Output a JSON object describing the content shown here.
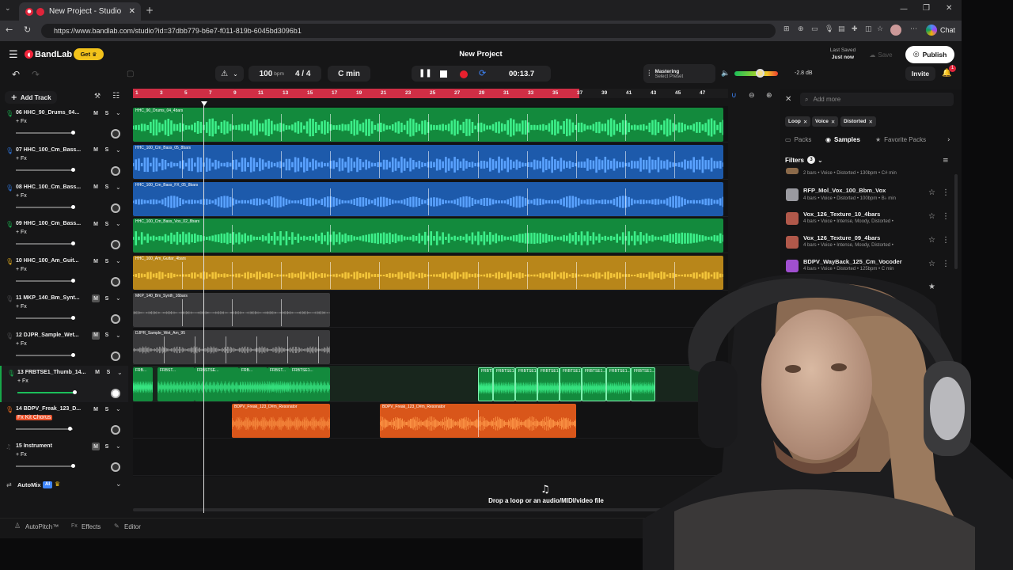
{
  "browser": {
    "tab_title": "New Project - Studio",
    "url": "https://www.bandlab.com/studio?id=37dbb779-b6e7-f011-819b-6045bd3096b1",
    "chat_label": "Chat"
  },
  "header": {
    "brand": "BandLab",
    "get_label": "Get",
    "project_title": "New Project",
    "last_saved_label": "Last Saved",
    "last_saved_value": "Just now",
    "save_label": "Save",
    "publish_label": "Publish",
    "invite_label": "Invite",
    "notif_count": "1"
  },
  "transport": {
    "tempo": "100",
    "tempo_unit": "bpm",
    "time_sig": "4 / 4",
    "key": "C min",
    "time": "00:13.7",
    "mastering_title": "Mastering",
    "mastering_preset": "Select Preset",
    "volume_db": "-2.8 dB"
  },
  "toolbar": {
    "add_track_label": "Add Track"
  },
  "ruler": {
    "bars": [
      "1",
      "3",
      "5",
      "7",
      "9",
      "11",
      "13",
      "15",
      "17",
      "19",
      "21",
      "23",
      "25",
      "27",
      "29",
      "31",
      "33",
      "35",
      "37",
      "39",
      "41",
      "43",
      "45",
      "47"
    ]
  },
  "tracks": [
    {
      "name": "06  HHC_90_Drums_04...",
      "fx": "+ Fx",
      "color": "#17a84a"
    },
    {
      "name": "07  HHC_100_Cm_Bass...",
      "fx": "+ Fx",
      "color": "#2c6fd1"
    },
    {
      "name": "08  HHC_100_Cm_Bass...",
      "fx": "+ Fx",
      "color": "#2c6fd1"
    },
    {
      "name": "09  HHC_100_Cm_Bass...",
      "fx": "+ Fx",
      "color": "#17a84a"
    },
    {
      "name": "10  HHC_100_Am_Guit...",
      "fx": "+ Fx",
      "color": "#d6a21c"
    },
    {
      "name": "11  MKP_140_Bm_Synt...",
      "fx": "+ Fx",
      "color": "#4a4a4c"
    },
    {
      "name": "12  DJPR_Sample_Wet...",
      "fx": "+ Fx",
      "color": "#4a4a4c"
    },
    {
      "name": "13  FRBTSE1_Thumb_14...",
      "fx": "+ Fx",
      "color": "#17a84a"
    },
    {
      "name": "14  BDPV_Freak_123_D...",
      "fx": "Fx Kit Chorus",
      "color": "#ee6a1c"
    },
    {
      "name": "15  Instrument",
      "fx": "+ Fx",
      "color": "#4a4a4c"
    }
  ],
  "clips": {
    "c0": "HHC_90_Drums_04_4bars",
    "c1": "HHC_100_Cm_Bass_05_8bars",
    "c2": "HHC_100_Cm_Bass_FX_05_8bars",
    "c3": "HHC_100_Cm_Bass_Vox_02_8bars",
    "c4": "HHC_100_Am_Guitar_4bars",
    "c5": "MKP_140_Bm_Synth_16bars",
    "c6": "DJPR_Sample_Wet_Am_95",
    "c7a": "FRB...",
    "c7b": "FRBST...",
    "c7c": "FRBSTSE...",
    "c7d": "FRBTSE1...",
    "c8a": "BDPV_Freak_123_D#m_Resonator",
    "c8b": "BDPV_Freak_123_D#m_Resonator"
  },
  "automix": {
    "label": "AutoMix",
    "badge": "AI"
  },
  "drop_text": "Drop a loop or an audio/MIDI/video file",
  "bottom": {
    "autopitch": "AutoPitch™",
    "effects": "Effects",
    "editor": "Editor"
  },
  "samples": {
    "search_placeholder": "Add more",
    "chips": [
      "Loop",
      "Voice",
      "Distorted"
    ],
    "tabs": {
      "packs": "Packs",
      "samples": "Samples",
      "favorites": "Favorite Packs"
    },
    "filters_label": "Filters",
    "filters_count": "3",
    "items": [
      {
        "title": "",
        "sub": "2 bars • Voice • Distorted • 130bpm • C# min",
        "color": "#8b6a4a"
      },
      {
        "title": "RFP_Mol_Vox_100_Bbm_Vox",
        "sub": "4 bars • Voice • Distorted • 100bpm • B♭ min",
        "color": "#9a9aa0"
      },
      {
        "title": "Vox_126_Texture_10_4bars",
        "sub": "4 bars • Voice • Intense, Moody, Distorted •",
        "color": "#b0584a"
      },
      {
        "title": "Vox_126_Texture_09_4bars",
        "sub": "4 bars • Voice • Intense, Moody, Distorted •",
        "color": "#b0584a"
      },
      {
        "title": "BDPV_WayBack_125_Cm_Vocoder",
        "sub": "4 bars • Voice • Distorted • 125bpm • C min",
        "color": "#a04fd0"
      }
    ]
  }
}
